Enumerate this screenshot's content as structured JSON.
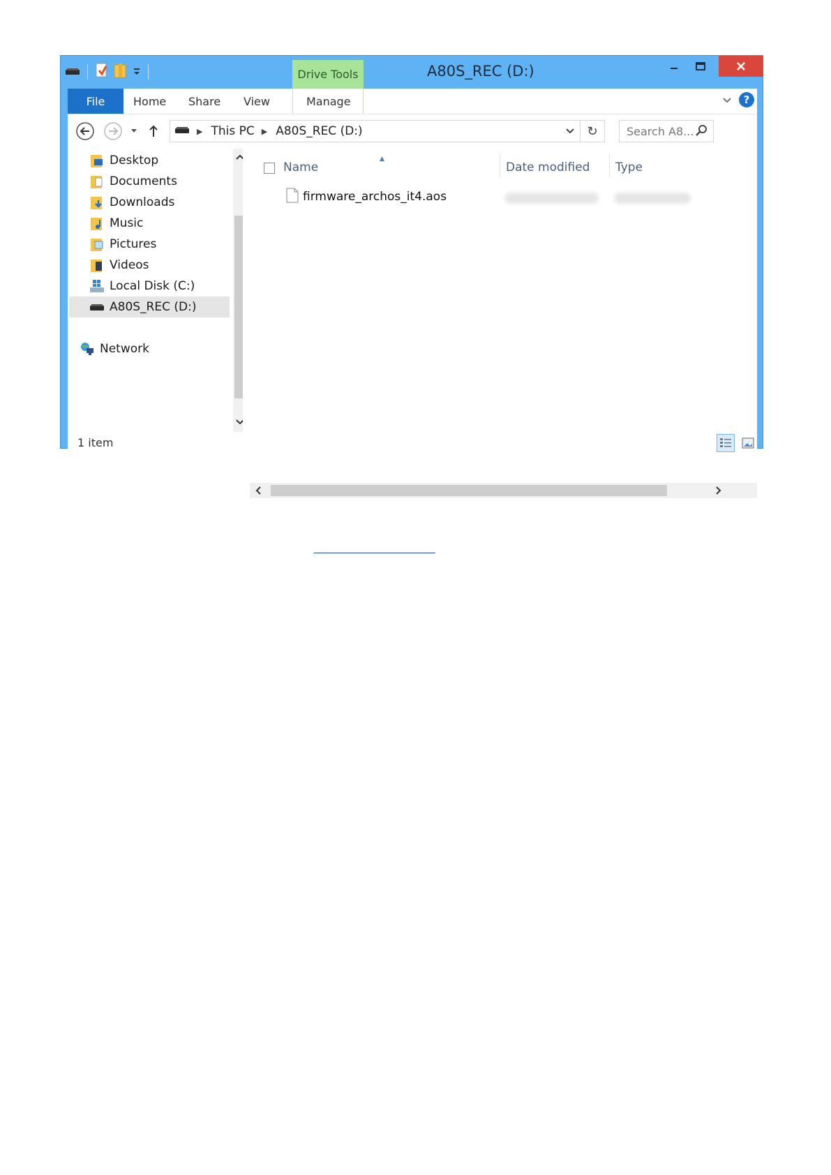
{
  "window": {
    "title": "A80S_REC (D:)",
    "contextual_tab_group": "Drive Tools",
    "accent": "#5fb2f4",
    "close_color": "#d9463c"
  },
  "ribbon": {
    "tabs": [
      "File",
      "Home",
      "Share",
      "View",
      "Manage"
    ]
  },
  "address_bar": {
    "breadcrumbs": [
      "This PC",
      "A80S_REC (D:)"
    ],
    "search_placeholder": "Search A8..."
  },
  "nav_pane": {
    "items": [
      {
        "label": "Desktop",
        "icon": "desktop-folder-icon"
      },
      {
        "label": "Documents",
        "icon": "documents-folder-icon"
      },
      {
        "label": "Downloads",
        "icon": "downloads-folder-icon"
      },
      {
        "label": "Music",
        "icon": "music-folder-icon"
      },
      {
        "label": "Pictures",
        "icon": "pictures-folder-icon"
      },
      {
        "label": "Videos",
        "icon": "videos-folder-icon"
      },
      {
        "label": "Local Disk (C:)",
        "icon": "local-disk-icon"
      },
      {
        "label": "A80S_REC (D:)",
        "icon": "removable-drive-icon",
        "selected": true
      }
    ],
    "network": {
      "label": "Network",
      "icon": "network-icon"
    }
  },
  "content": {
    "columns": [
      "Name",
      "Date modified",
      "Type"
    ],
    "files": [
      {
        "name": "firmware_archos_it4.aos",
        "icon": "file-icon"
      }
    ]
  },
  "status": {
    "item_count": "1 item"
  }
}
